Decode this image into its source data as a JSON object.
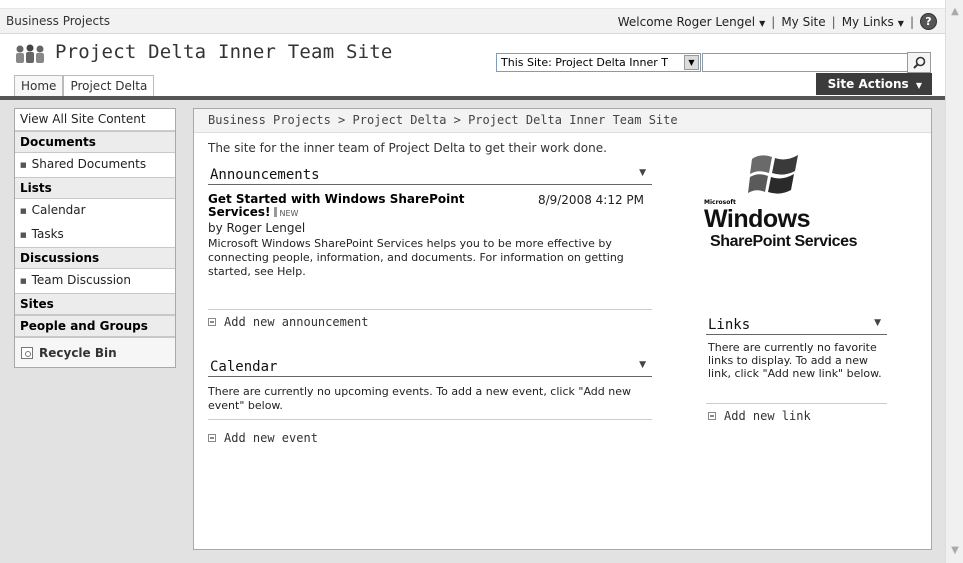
{
  "global": {
    "breadcrumb": "Business Projects",
    "welcome": "Welcome Roger Lengel",
    "my_site": "My Site",
    "my_links": "My Links",
    "help_icon": "help-icon"
  },
  "header": {
    "site_title": "Project Delta Inner Team Site",
    "search_scope": "This Site: Project Delta Inner T",
    "search_value": "",
    "site_actions": "Site Actions"
  },
  "topnav": {
    "tabs": [
      {
        "label": "Home"
      },
      {
        "label": "Project Delta"
      }
    ]
  },
  "leftnav": {
    "view_all": "View All Site Content",
    "documents": {
      "heading": "Documents",
      "items": [
        {
          "label": "Shared Documents"
        }
      ]
    },
    "lists": {
      "heading": "Lists",
      "items": [
        {
          "label": "Calendar"
        },
        {
          "label": "Tasks"
        }
      ]
    },
    "discussions": {
      "heading": "Discussions",
      "items": [
        {
          "label": "Team Discussion"
        }
      ]
    },
    "sites": "Sites",
    "people": "People and Groups",
    "recycle_bin": "Recycle Bin"
  },
  "main": {
    "breadcrumb": "Business Projects > Project Delta > Project Delta Inner Team Site",
    "description": "The site for the inner team of Project Delta to get their work done.",
    "announcements": {
      "title": "Announcements",
      "item": {
        "title": "Get Started with Windows SharePoint Services!",
        "new_badge": "NEW",
        "date": "8/9/2008 4:12 PM",
        "author": "by Roger Lengel",
        "body": "Microsoft Windows SharePoint Services helps you to be more effective by connecting people, information, and documents. For information on getting started, see Help."
      },
      "add_label": "Add new announcement"
    },
    "calendar": {
      "title": "Calendar",
      "empty_text": "There are currently no upcoming events. To add a new event, click \"Add new event\" below.",
      "add_label": "Add new event"
    },
    "logo": {
      "microsoft": "Microsoft",
      "windows": "Windows",
      "product": "SharePoint Services"
    },
    "links": {
      "title": "Links",
      "empty_text": "There are currently no favorite links to display. To add a new link, click \"Add new link\" below.",
      "add_label": "Add new link"
    }
  },
  "colors": {
    "site_actions_bg": "#3c3c3c",
    "body_bg": "#e2e2e2",
    "header_band": "#f2f2f2"
  }
}
